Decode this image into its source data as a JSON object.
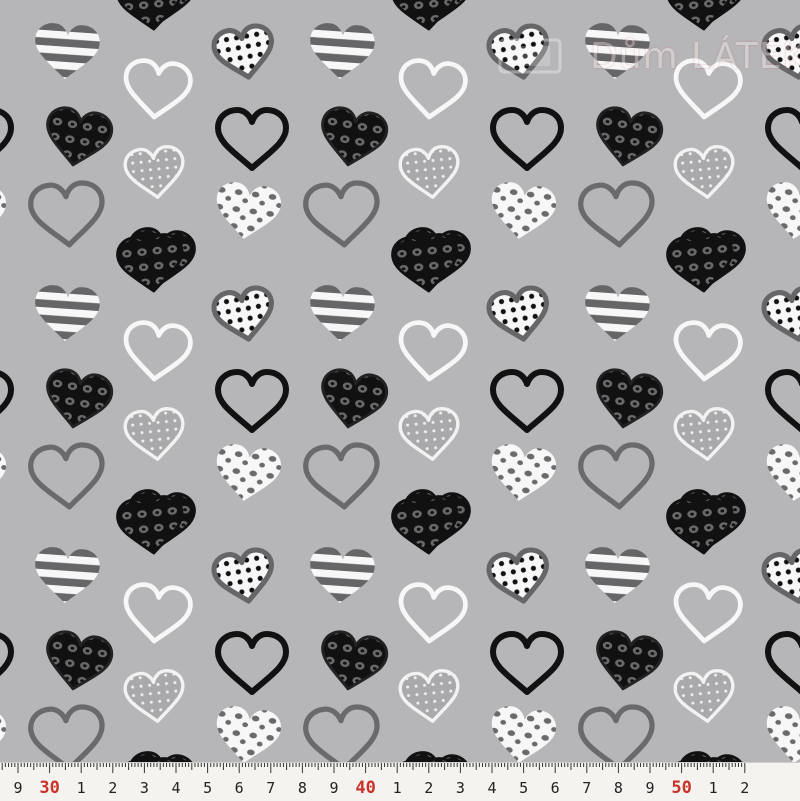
{
  "image": {
    "subject": "fabric-swatch",
    "pattern": "hearts",
    "colors": {
      "background": "#b6b6b8",
      "black": "#111111",
      "dark_gray": "#666668",
      "white": "#f7f7f7",
      "ruler_bg": "#f4f3ef",
      "ruler_major": "#c8332a"
    }
  },
  "watermark": {
    "text": "Dům LÁTEK.cz"
  },
  "ruler": {
    "labels": [
      "9",
      "30",
      "1",
      "2",
      "3",
      "4",
      "5",
      "6",
      "7",
      "8",
      "9",
      "40",
      "1",
      "2",
      "3",
      "4",
      "5",
      "6",
      "7",
      "8",
      "9",
      "50",
      "1",
      "2"
    ],
    "major_labels": [
      "30",
      "40",
      "50"
    ]
  }
}
